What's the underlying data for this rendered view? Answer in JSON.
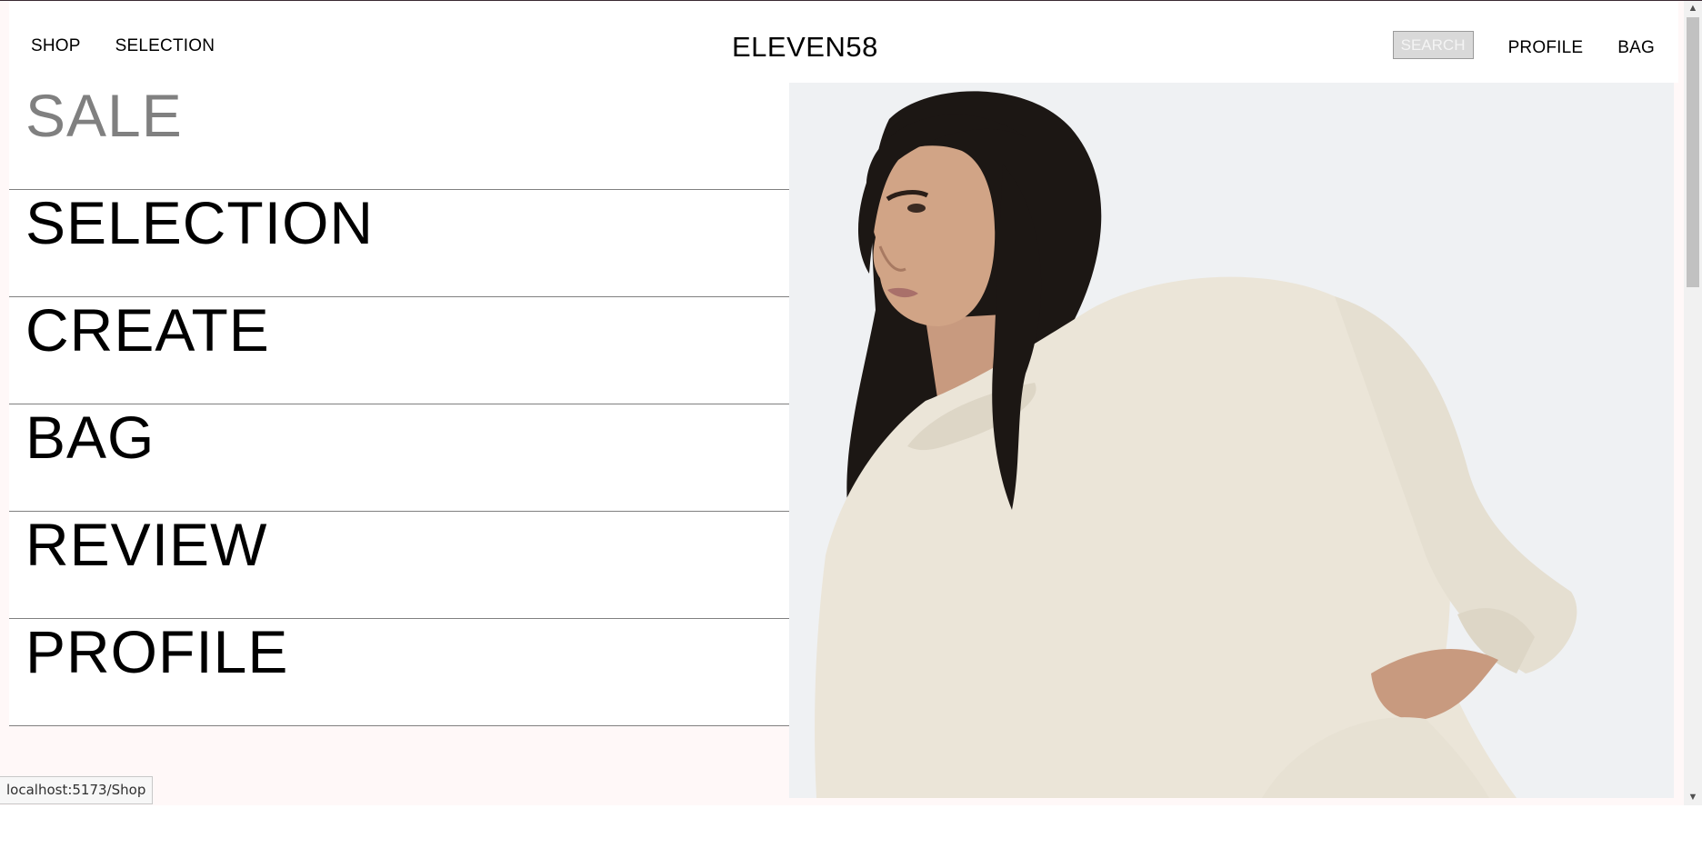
{
  "header": {
    "nav_left": [
      "SHOP",
      "SELECTION"
    ],
    "brand": "ELEVEN58",
    "search_label": "SEARCH",
    "profile_label": "PROFILE",
    "bag_label": "BAG"
  },
  "menu": {
    "items": [
      {
        "label": "SALE",
        "active": true
      },
      {
        "label": "SELECTION",
        "active": false
      },
      {
        "label": "CREATE",
        "active": false
      },
      {
        "label": "BAG",
        "active": false
      },
      {
        "label": "REVIEW",
        "active": false
      },
      {
        "label": "PROFILE",
        "active": false
      }
    ]
  },
  "hero": {
    "image": "model-in-cream-sweatshirt-photo"
  },
  "status_bar": {
    "url": "localhost:5173/Shop"
  },
  "colors": {
    "page_background": "#fff8f8",
    "active_menu_text": "#808080",
    "hero_background": "#eff1f3",
    "sweatshirt": "#ebe5d8"
  }
}
